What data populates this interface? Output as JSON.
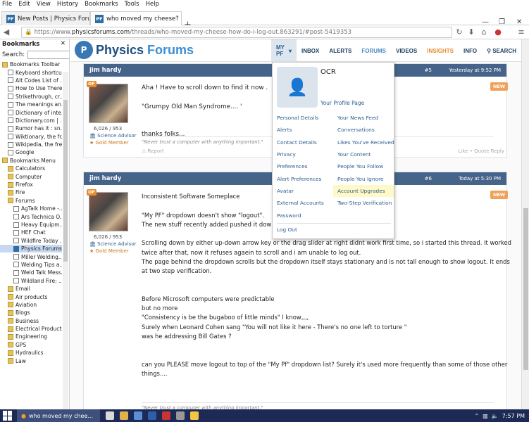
{
  "menubar": {
    "items": [
      "File",
      "Edit",
      "View",
      "History",
      "Bookmarks",
      "Tools",
      "Help"
    ]
  },
  "tabs": [
    {
      "title": "New Posts | Physics Foru..."
    },
    {
      "title": "who moved my cheese? h..."
    }
  ],
  "url": {
    "prefix": "https://www.",
    "host": "physicsforums.com",
    "path": "/threads/who-moved-my-cheese-how-do-i-log-out.863291/#post-5419353"
  },
  "sidebar": {
    "title": "Bookmarks",
    "search_label": "Search:",
    "items": [
      {
        "label": "Bookmarks Toolbar",
        "kind": "folder"
      },
      {
        "label": "Keyboard shortcu...",
        "kind": "page"
      },
      {
        "label": "Alt Codes List of ...",
        "kind": "page"
      },
      {
        "label": "How to Use There...",
        "kind": "page"
      },
      {
        "label": "Strikethrough, cr...",
        "kind": "page"
      },
      {
        "label": "The meanings an...",
        "kind": "page"
      },
      {
        "label": "Dictionary of inte...",
        "kind": "page"
      },
      {
        "label": "Dictionary.com | ...",
        "kind": "page"
      },
      {
        "label": "Rumor has it : sn...",
        "kind": "page"
      },
      {
        "label": "Wiktionary, the fr...",
        "kind": "page"
      },
      {
        "label": "Wikipedia, the fre...",
        "kind": "page"
      },
      {
        "label": "Google",
        "kind": "page"
      },
      {
        "label": "Bookmarks Menu",
        "kind": "folder"
      },
      {
        "label": "Calculators",
        "kind": "folder"
      },
      {
        "label": "Computer",
        "kind": "folder"
      },
      {
        "label": "Firefox",
        "kind": "folder"
      },
      {
        "label": "Fire",
        "kind": "folder"
      },
      {
        "label": "Forums",
        "kind": "folder"
      },
      {
        "label": "AgTalk Home -...",
        "kind": "page"
      },
      {
        "label": "Ars Technica O...",
        "kind": "page"
      },
      {
        "label": "Heavy Equipm...",
        "kind": "page"
      },
      {
        "label": "HEF Chat",
        "kind": "page"
      },
      {
        "label": "Wildfire Today ...",
        "kind": "page"
      },
      {
        "label": "Physics Forums...",
        "kind": "fav"
      },
      {
        "label": "Miller Welding...",
        "kind": "page"
      },
      {
        "label": "Welding Tips a...",
        "kind": "page"
      },
      {
        "label": "Weld Talk Mess...",
        "kind": "page"
      },
      {
        "label": "Wildland Fire: ...",
        "kind": "page"
      },
      {
        "label": "Email",
        "kind": "folder"
      },
      {
        "label": "Air products",
        "kind": "folder"
      },
      {
        "label": "Aviation",
        "kind": "folder"
      },
      {
        "label": "Blogs",
        "kind": "folder"
      },
      {
        "label": "Business",
        "kind": "folder"
      },
      {
        "label": "Electrical Products",
        "kind": "folder"
      },
      {
        "label": "Engineering",
        "kind": "folder"
      },
      {
        "label": "GPS",
        "kind": "folder"
      },
      {
        "label": "Hydraulics",
        "kind": "folder"
      },
      {
        "label": "Law",
        "kind": "folder"
      }
    ]
  },
  "site": {
    "logo_a": "Physics ",
    "logo_b": "Forums",
    "nav": [
      "MY PF",
      "INBOX",
      "ALERTS",
      "FORUMS",
      "VIDEOS",
      "INSIGHTS",
      "INFO",
      "SEARCH"
    ]
  },
  "posts": [
    {
      "author": "jim hardy",
      "number": "#5",
      "time": "Yesterday at 9:52 PM",
      "op": "OP",
      "stats": "6,026 / 953",
      "role": "Science Advisor",
      "gold": "Gold Member",
      "badge": "NEW",
      "body": "Aha ! Have to scroll down to find it now .\n\n\"Grumpy Old Man Syndrome.... '\n\n\nthanks folks...",
      "signature": "\"Never trust a computer with anything important.\"",
      "report": "Report",
      "actions": "Like  • Quote  Reply"
    },
    {
      "author": "jim hardy",
      "number": "#6",
      "time": "Today at 5:30 PM",
      "op": "OP",
      "stats": "6,026 / 953",
      "role": "Science Advisor",
      "gold": "Gold Member",
      "badge": "NEW",
      "body": "Inconsistent Software Someplace\n\n\"My PF\" dropdown doesn't show \"logout\".\nThe new stuff recently added pushed it down b\n\nScrolling down by either up-down arrow key or the drag slider at right didnt work first time, so i started this thread. It worked\ntwice after that, now it refuses agaein to scroll and i am unable to log out.\nThe page behind the dropdown scrolls but the dropdown itself stays stationary and is not tall enough to show logout. It ends\nat two step verification.\n\n\nBefore Microsoft computers were predictable\nbut no more\n\"Consistency is be the bugaboo of little minds\" I know,,,,\nSurely when Leonard Cohen sang \"You will not like it here - There's no one left to torture \"\nwas he addressing Bill Gates ?\n\n\ncan you PLEASE move logout to top of the \"My Pf\" dropdown list? Surely it's used more frequently than some of those other\nthings....",
      "signature": "\"Never trust a computer with anything important.\""
    }
  ],
  "dropdown": {
    "name": "OCR",
    "profile_link": "Your Profile Page",
    "left": [
      "Personal Details",
      "Alerts",
      "Contact Details",
      "Privacy",
      "Preferences",
      "Alert Preferences",
      "Avatar",
      "External Accounts",
      "Password"
    ],
    "right": [
      "Your News Feed",
      "Conversations",
      "Likes You've Received",
      "Your Content",
      "People You Follow",
      "People You Ignore",
      "Account Upgrades",
      "Two-Step Verification"
    ],
    "highlighted": "Account Upgrades",
    "logout": "Log Out"
  },
  "taskbar": {
    "app": "who moved my chee...",
    "time": "7:57 PM"
  },
  "colors": {
    "header_blue": "#46648a",
    "brand": "#1d4f80",
    "insights": "#e58c2d"
  }
}
